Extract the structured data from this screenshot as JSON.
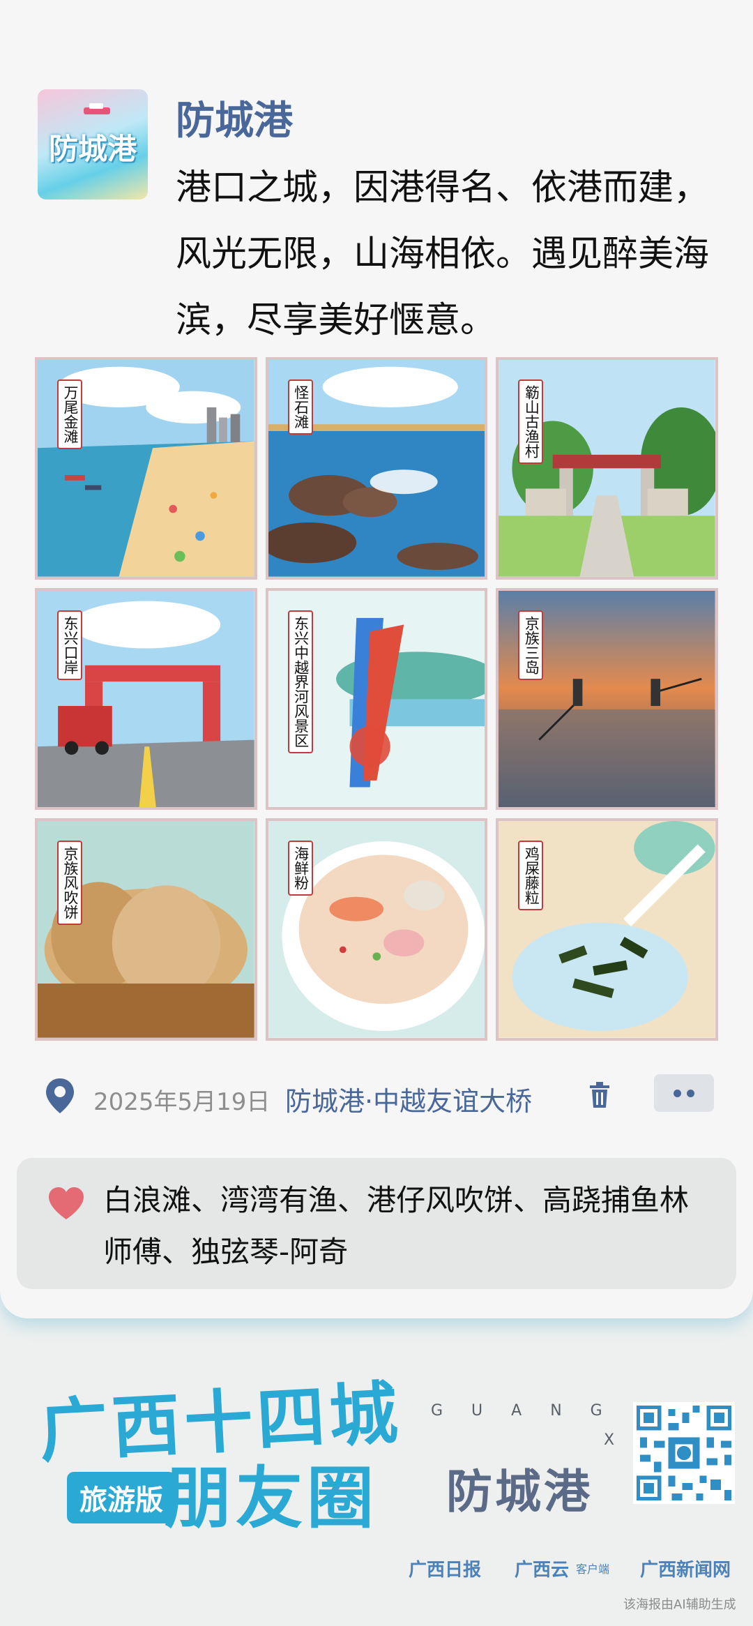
{
  "post": {
    "avatar_text": "防城港",
    "title": "防城港",
    "description": "港口之城，因港得名、依港而建，风光无限，山海相依。遇见醉美海滨，尽享美好惬意。"
  },
  "photos": [
    {
      "label": "万尾金滩"
    },
    {
      "label": "怪石滩"
    },
    {
      "label": "簕山古渔村"
    },
    {
      "label": "东兴口岸"
    },
    {
      "label": "东兴中越界河风景区"
    },
    {
      "label": "京族三岛"
    },
    {
      "label": "京族风吹饼"
    },
    {
      "label": "海鲜粉"
    },
    {
      "label": "鸡屎藤粒"
    }
  ],
  "meta": {
    "date": "2025年5月19日",
    "location": "防城港·中越友谊大桥"
  },
  "likes": {
    "names": "白浪滩、湾湾有渔、港仔风吹饼、高跷捕鱼林师傅、独弦琴-阿奇"
  },
  "footer": {
    "brand_line1": "广西十四城",
    "brand_line2": "朋友圈",
    "badge": "旅游版",
    "guangxi_top": "GUANG",
    "guangxi_bottom": "XI",
    "city": "防城港",
    "logo1": "广西日报",
    "logo2": "广西云",
    "logo2_sub": "客户端",
    "logo3": "广西新闻网",
    "ai_note": "该海报由AI辅助生成"
  },
  "colors": {
    "accent": "#4a6799",
    "brand": "#2aa9d4",
    "heart": "#e46a73"
  }
}
